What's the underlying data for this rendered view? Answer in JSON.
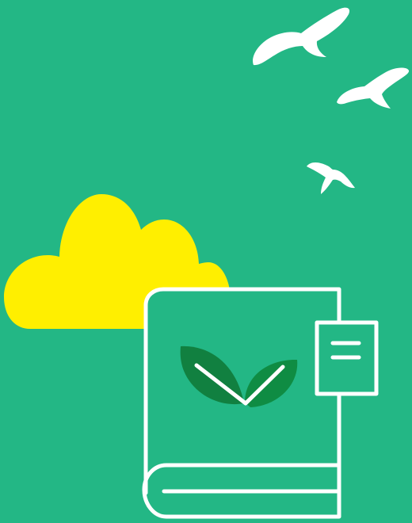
{
  "colors": {
    "background": "#23b785",
    "cloud": "#ffef00",
    "outline": "#ffffff",
    "leaf_dark": "#118040",
    "leaf_mid": "#0f8c43"
  },
  "icons": {
    "birds": [
      "bird-icon",
      "bird-icon",
      "bird-icon"
    ],
    "cloud": "cloud-icon",
    "book": "book-icon",
    "leaves": "leaf-icon",
    "bookmark_tag": "bookmark-icon"
  }
}
